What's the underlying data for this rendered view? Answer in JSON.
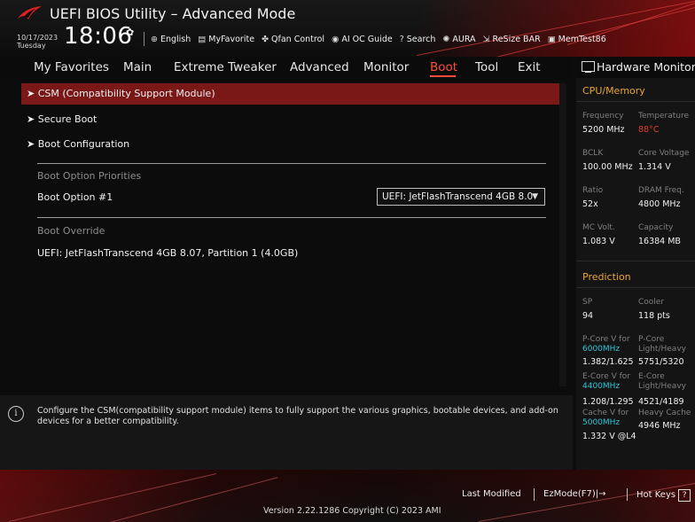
{
  "header": {
    "title": "UEFI BIOS Utility – Advanced Mode",
    "date": "10/17/2023",
    "day": "Tuesday",
    "time": "18:06",
    "quick_items": [
      {
        "icon": "globe-icon",
        "glyph": "⊕",
        "label": "English"
      },
      {
        "icon": "favorite-icon",
        "glyph": "▤",
        "label": "MyFavorite"
      },
      {
        "icon": "fan-icon",
        "glyph": "✤",
        "label": "Qfan Control"
      },
      {
        "icon": "ai-icon",
        "glyph": "◉",
        "label": "AI OC Guide"
      },
      {
        "icon": "search-icon",
        "glyph": "?",
        "label": "Search"
      },
      {
        "icon": "aura-icon",
        "glyph": "✺",
        "label": "AURA"
      },
      {
        "icon": "resize-bar-icon",
        "glyph": "⇲",
        "label": "ReSize BAR"
      },
      {
        "icon": "memtest-icon",
        "glyph": "▣",
        "label": "MemTest86"
      }
    ]
  },
  "nav": {
    "tabs": [
      "My Favorites",
      "Main",
      "Extreme Tweaker",
      "Advanced",
      "Monitor",
      "Boot",
      "Tool",
      "Exit"
    ],
    "active": "Boot"
  },
  "main": {
    "items": [
      "CSM (Compatibility Support Module)",
      "Secure Boot",
      "Boot Configuration"
    ],
    "section_priorities": "Boot Option Priorities",
    "boot_option_label": "Boot Option #1",
    "boot_option_value": "UEFI: JetFlashTranscend 4GB 8.0",
    "section_override": "Boot Override",
    "override_item": "UEFI: JetFlashTranscend 4GB 8.07, Partition 1 (4.0GB)"
  },
  "help": {
    "text": "Configure the CSM(compatibility support module) items to fully support the various graphics, bootable devices, and add-on devices for a better compatibility."
  },
  "hw": {
    "title": "Hardware Monitor",
    "cpu_section": "CPU/Memory",
    "frequency_label": "Frequency",
    "frequency_value": "5200 MHz",
    "temperature_label": "Temperature",
    "temperature_value": "88°C",
    "bclk_label": "BCLK",
    "bclk_value": "100.00 MHz",
    "core_voltage_label": "Core Voltage",
    "core_voltage_value": "1.314 V",
    "ratio_label": "Ratio",
    "ratio_value": "52x",
    "dram_label": "DRAM Freq.",
    "dram_value": "4800 MHz",
    "mc_label": "MC Volt.",
    "mc_value": "1.083 V",
    "capacity_label": "Capacity",
    "capacity_value": "16384 MB",
    "prediction_section": "Prediction",
    "sp_label": "SP",
    "sp_value": "94",
    "cooler_label": "Cooler",
    "cooler_value": "118 pts",
    "pcore_v_label": "P-Core V for",
    "pcore_v_freq": "6000MHz",
    "pcore_v_value": "1.382/1.625",
    "pcore_lh_label": "P-Core Light/Heavy",
    "pcore_lh_value": "5751/5320",
    "ecore_v_label": "E-Core V for",
    "ecore_v_freq": "4400MHz",
    "ecore_v_value": "1.208/1.295",
    "ecore_lh_label": "E-Core Light/Heavy",
    "ecore_lh_value": "4521/4189",
    "cache_v_label": "Cache V for",
    "cache_v_freq": "5000MHz",
    "cache_v_value": "1.332 V @L4",
    "heavy_cache_label": "Heavy Cache",
    "heavy_cache_value": "4946 MHz"
  },
  "footer": {
    "version": "Version 2.22.1286 Copyright (C) 2023 AMI",
    "last_modified": "Last Modified",
    "ezmode": "EzMode(F7)|",
    "hotkeys": "Hot Keys",
    "hotkeys_key": "?"
  },
  "colors": {
    "accent": "#ff4d3d",
    "selected_row": "#7a1717",
    "section_yellow": "#e6a532",
    "cyan": "#2fc4d6"
  }
}
